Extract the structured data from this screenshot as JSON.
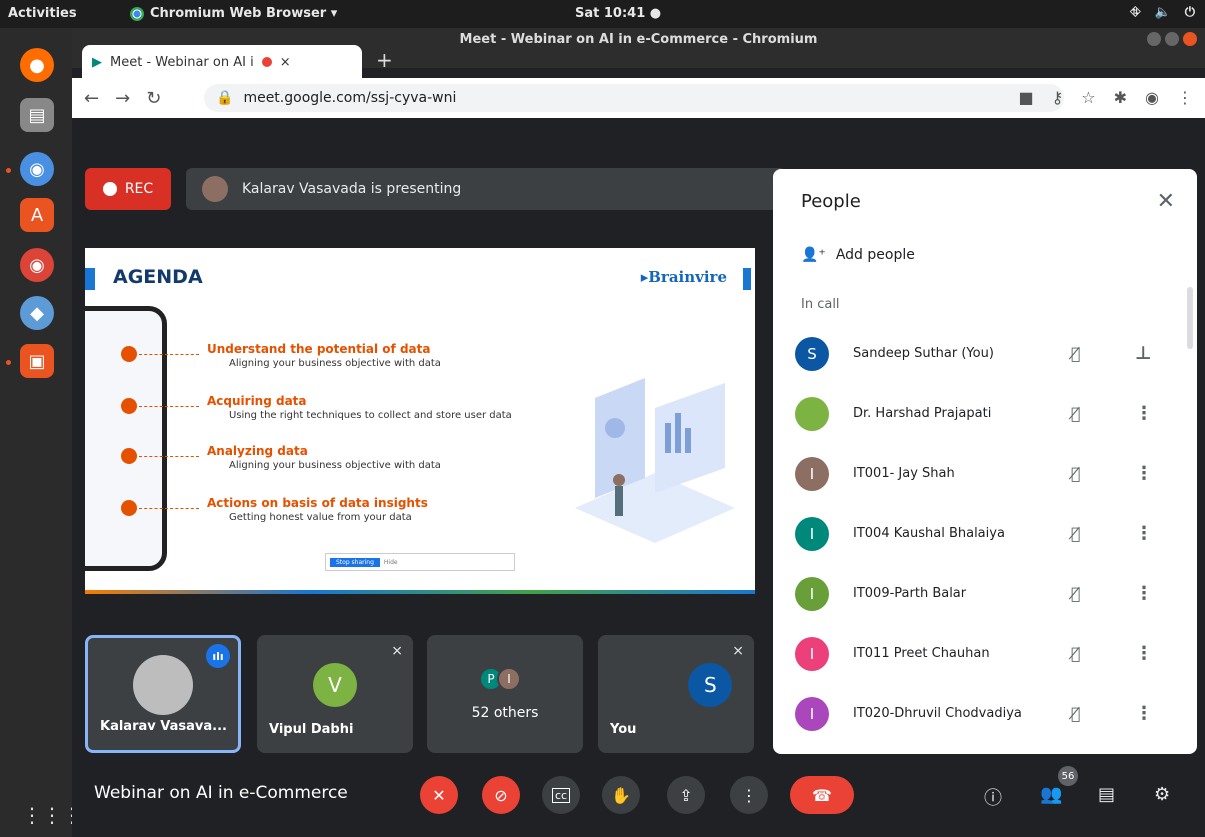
{
  "os_bar": {
    "activities": "Activities",
    "app_menu": "Chromium Web Browser ▾",
    "clock": "Sat 10:41 ●"
  },
  "window": {
    "title": "Meet - Webinar on AI in e-Commerce - Chromium"
  },
  "browser": {
    "tab_title": "Meet - Webinar on AI i",
    "tab_close": "×",
    "new_tab": "+",
    "url": "meet.google.com/ssj-cyva-wni"
  },
  "meet": {
    "rec_label": "REC",
    "presenting_text": "Kalarav Vasavada is presenting",
    "meeting_title": "Webinar on AI in e-Commerce",
    "participant_badge": "56"
  },
  "slide": {
    "heading": "AGENDA",
    "brand": "▸Brainvire",
    "items": [
      {
        "title": "Understand the potential of data",
        "sub": "Aligning your business objective with data"
      },
      {
        "title": "Acquiring data",
        "sub": "Using the right techniques to collect and store user data"
      },
      {
        "title": "Analyzing data",
        "sub": "Aligning your business objective with data"
      },
      {
        "title": "Actions on basis of data insights",
        "sub": "Getting honest value from your data"
      }
    ],
    "share_stop": "Stop sharing",
    "share_hide": "Hide"
  },
  "tiles": [
    {
      "name": "Kalarav Vasava...",
      "avatar": ""
    },
    {
      "name": "Vipul Dabhi",
      "avatar": "V"
    },
    {
      "name": "52 others",
      "avatar_p": "P",
      "avatar_i": "I"
    },
    {
      "name": "You",
      "avatar": "S"
    }
  ],
  "people_panel": {
    "title": "People",
    "close": "✕",
    "add_people": "Add people",
    "in_call": "In call",
    "participants": [
      {
        "name": "Sandeep Suthar (You)",
        "initial": "S",
        "color": "#0b57a4",
        "action": "pin"
      },
      {
        "name": "Dr. Harshad Prajapati",
        "initial": "",
        "color": "#7cb342",
        "action": "more"
      },
      {
        "name": "IT001- Jay Shah",
        "initial": "I",
        "color": "#8d6e63",
        "action": "more"
      },
      {
        "name": "IT004 Kaushal Bhalaiya",
        "initial": "I",
        "color": "#00897b",
        "action": "more"
      },
      {
        "name": "IT009-Parth Balar",
        "initial": "I",
        "color": "#689f38",
        "action": "more"
      },
      {
        "name": "IT011 Preet Chauhan",
        "initial": "I",
        "color": "#ec407a",
        "action": "more"
      },
      {
        "name": "IT020-Dhruvil Chodvadiya",
        "initial": "I",
        "color": "#ab47bc",
        "action": "more"
      }
    ]
  },
  "colors": {
    "meet_bg": "#202124",
    "tile_bg": "#3c4043",
    "danger": "#ea4335",
    "accent": "#1a73e8",
    "ubuntu_orange": "#e95420"
  }
}
